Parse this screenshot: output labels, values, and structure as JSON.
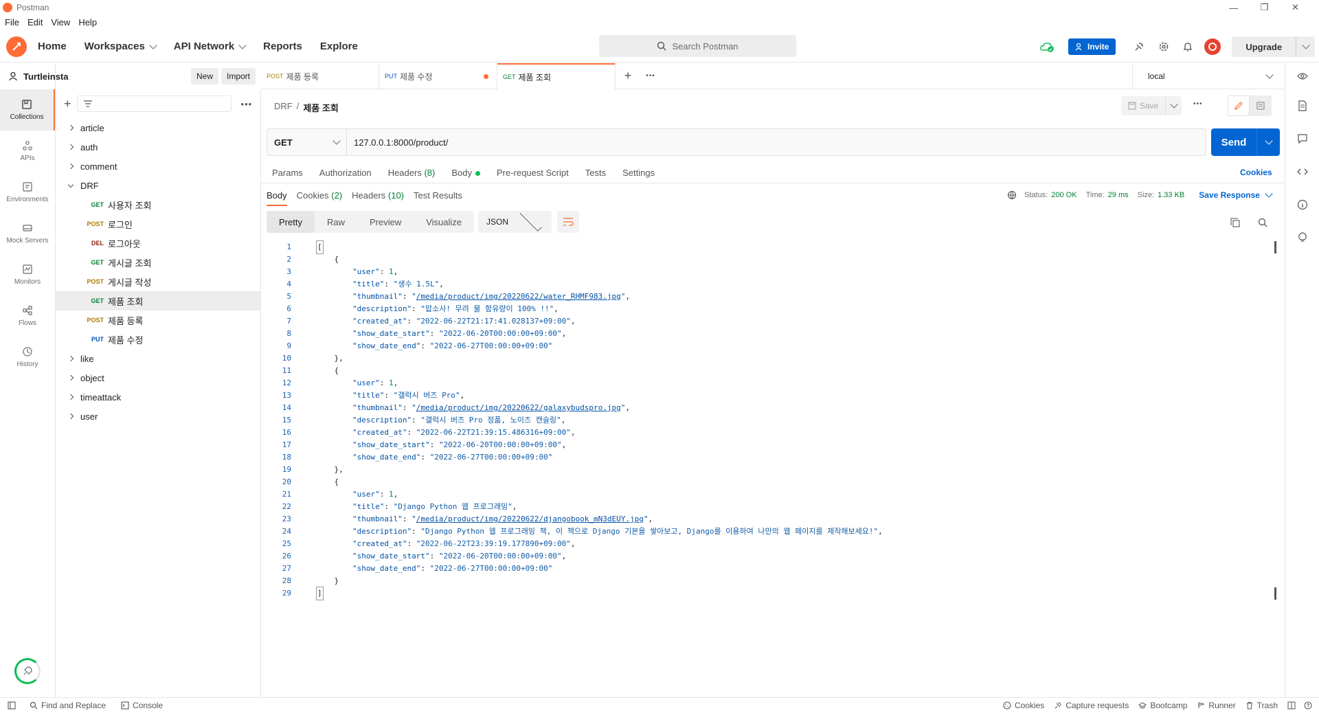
{
  "window": {
    "title": "Postman"
  },
  "menu": [
    "File",
    "Edit",
    "View",
    "Help"
  ],
  "header": {
    "nav": [
      "Home",
      "Workspaces",
      "API Network",
      "Reports",
      "Explore"
    ],
    "search_placeholder": "Search Postman",
    "invite_label": "Invite",
    "upgrade_label": "Upgrade"
  },
  "workspace": {
    "name": "Turtleinsta",
    "new_label": "New",
    "import_label": "Import"
  },
  "rail": [
    "Collections",
    "APIs",
    "Environments",
    "Mock Servers",
    "Monitors",
    "Flows",
    "History"
  ],
  "collections": {
    "folders_before": [
      "article",
      "auth",
      "comment"
    ],
    "open_folder": "DRF",
    "requests": [
      {
        "method": "GET",
        "name": "사용자 조회"
      },
      {
        "method": "POST",
        "name": "로그인"
      },
      {
        "method": "DEL",
        "name": "로그아웃"
      },
      {
        "method": "GET",
        "name": "게시글 조회"
      },
      {
        "method": "POST",
        "name": "게시글 작성"
      },
      {
        "method": "GET",
        "name": "제품 조회"
      },
      {
        "method": "POST",
        "name": "제품 등록"
      },
      {
        "method": "PUT",
        "name": "제품 수정"
      }
    ],
    "folders_after": [
      "like",
      "object",
      "timeattack",
      "user"
    ]
  },
  "tabs": [
    {
      "method": "POST",
      "name": "제품 등록"
    },
    {
      "method": "PUT",
      "name": "제품 수정"
    },
    {
      "method": "GET",
      "name": "제품 조회"
    }
  ],
  "environment": "local",
  "breadcrumb": {
    "parent": "DRF",
    "separator": "/",
    "current": "제품 조회"
  },
  "save_label": "Save",
  "request": {
    "method": "GET",
    "url": "127.0.0.1:8000/product/",
    "send_label": "Send"
  },
  "request_tabs": [
    "Params",
    "Authorization",
    "Headers",
    "Body",
    "Pre-request Script",
    "Tests",
    "Settings"
  ],
  "request_headers_count": "(8)",
  "cookies_link": "Cookies",
  "response_tabs": [
    "Body",
    "Cookies",
    "Headers",
    "Test Results"
  ],
  "response_cookies_count": "(2)",
  "response_headers_count": "(10)",
  "status": {
    "status_label": "Status:",
    "status_value": "200 OK",
    "time_label": "Time:",
    "time_value": "29 ms",
    "size_label": "Size:",
    "size_value": "1.33 KB"
  },
  "save_response_label": "Save Response",
  "view_modes": [
    "Pretty",
    "Raw",
    "Preview",
    "Visualize"
  ],
  "format": "JSON",
  "response_body": [
    {
      "user": "1",
      "title": "생수 1.5L",
      "thumbnail": "/media/product/img/20220622/water_RHMF983.jpg",
      "description": "맙소사! 무려 물 함유량이 100% !!",
      "created_at": "2022-06-22T21:17:41.028137+09:00",
      "show_date_start": "2022-06-20T00:00:00+09:00",
      "show_date_end": "2022-06-27T00:00:00+09:00"
    },
    {
      "user": "1",
      "title": "갤럭시 버즈 Pro",
      "thumbnail": "/media/product/img/20220622/galaxybudspro.jpg",
      "description": "갤럭시 버즈 Pro 정품, 노이즈 캔슬링",
      "created_at": "2022-06-22T21:39:15.486316+09:00",
      "show_date_start": "2022-06-20T00:00:00+09:00",
      "show_date_end": "2022-06-27T00:00:00+09:00"
    },
    {
      "user": "1",
      "title": "Django Python 웹 프로그래밍",
      "thumbnail": "/media/product/img/20220622/djangobook_mN3dEUY.jpg",
      "description": "Django Python 웹 프로그래밍 책, 이 책으로 Django 기본을 쌓아보고, Django를 이용하여 나만의 웹 페이지를 제작해보세요!",
      "created_at": "2022-06-22T23:39:19.177890+09:00",
      "show_date_start": "2022-06-20T00:00:00+09:00",
      "show_date_end": "2022-06-27T00:00:00+09:00"
    }
  ],
  "footer": {
    "left": [
      "Find and Replace",
      "Console"
    ],
    "right": [
      "Cookies",
      "Capture requests",
      "Bootcamp",
      "Runner",
      "Trash"
    ]
  }
}
